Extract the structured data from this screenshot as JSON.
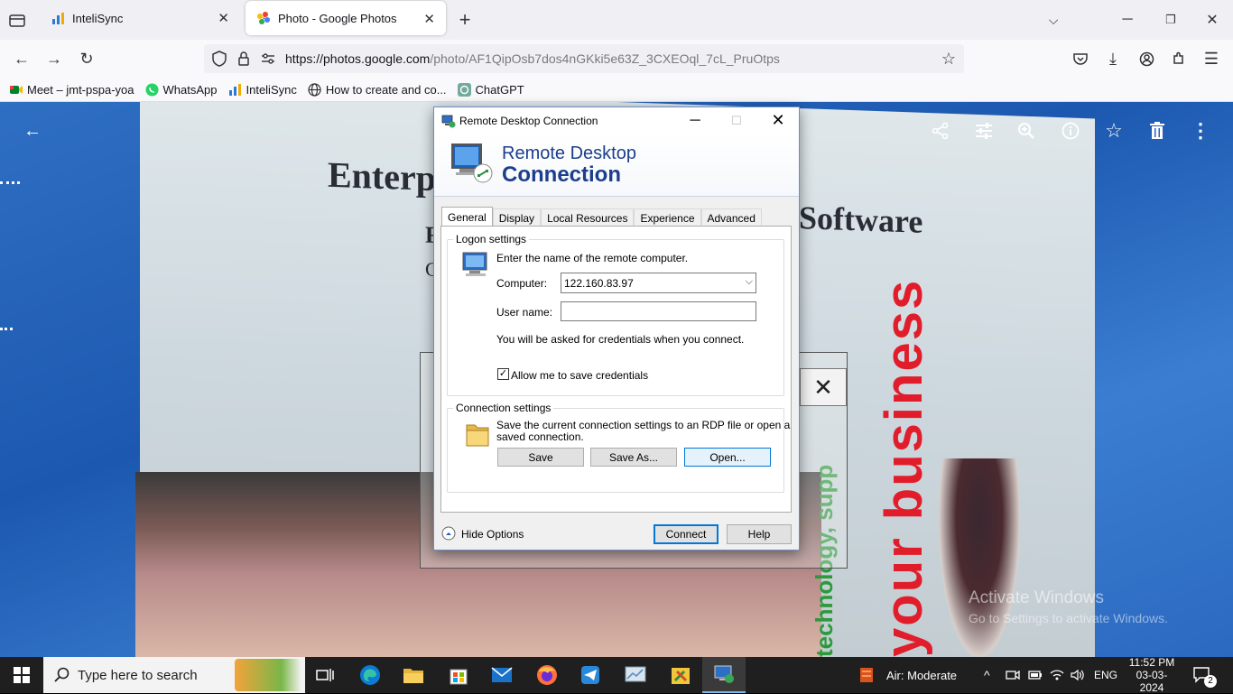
{
  "browser": {
    "tabs": [
      {
        "title": "InteliSync",
        "active": false
      },
      {
        "title": "Photo - Google Photos",
        "active": true
      }
    ],
    "url_domain": "https://photos.google.com",
    "url_path": "/photo/AF1QipOsb7dos4nGKki5e63Z_3CXEOql_7cL_PruOtps",
    "bookmarks": [
      {
        "label": "Meet – jmt-pspa-yoa",
        "icon": "google-meet-icon"
      },
      {
        "label": "WhatsApp",
        "icon": "whatsapp-icon"
      },
      {
        "label": "InteliSync",
        "icon": "intellisync-icon"
      },
      {
        "label": "How to create and co...",
        "icon": "globe-icon"
      },
      {
        "label": "ChatGPT",
        "icon": "chatgpt-icon"
      }
    ]
  },
  "photo": {
    "heading_left": "Enterp",
    "heading_right": "Software",
    "partial_letter_1": "F",
    "partial_letter_2": "C",
    "red_text": "your business",
    "green_text": "technology, supp"
  },
  "watermark": {
    "line1": "Activate Windows",
    "line2": "Go to Settings to activate Windows."
  },
  "rdc": {
    "title": "Remote Desktop Connection",
    "banner_line1": "Remote Desktop",
    "banner_line2": "Connection",
    "tabs": [
      "General",
      "Display",
      "Local Resources",
      "Experience",
      "Advanced"
    ],
    "logon_group": "Logon settings",
    "logon_instruction": "Enter the name of the remote computer.",
    "computer_label": "Computer:",
    "computer_value": "122.160.83.97",
    "username_label": "User name:",
    "username_value": "",
    "credentials_note": "You will be asked for credentials when you connect.",
    "save_credentials_label": "Allow me to save credentials",
    "save_credentials_checked": true,
    "connection_group": "Connection settings",
    "connection_note_1": "Save the current connection settings to an RDP file or open a",
    "connection_note_2": "saved connection.",
    "save_button": "Save",
    "save_as_button": "Save As...",
    "open_button": "Open...",
    "hide_options": "Hide Options",
    "connect_button": "Connect",
    "help_button": "Help"
  },
  "taskbar": {
    "search_placeholder": "Type here to search",
    "weather": "Air: Moderate",
    "language": "ENG",
    "time": "11:52 PM",
    "date": "03-03-2024",
    "notifications": "2"
  },
  "colors": {
    "accent": "#0078d7",
    "rdc_banner_text": "#1c3e8c",
    "taskbar": "#1f1f1f"
  }
}
